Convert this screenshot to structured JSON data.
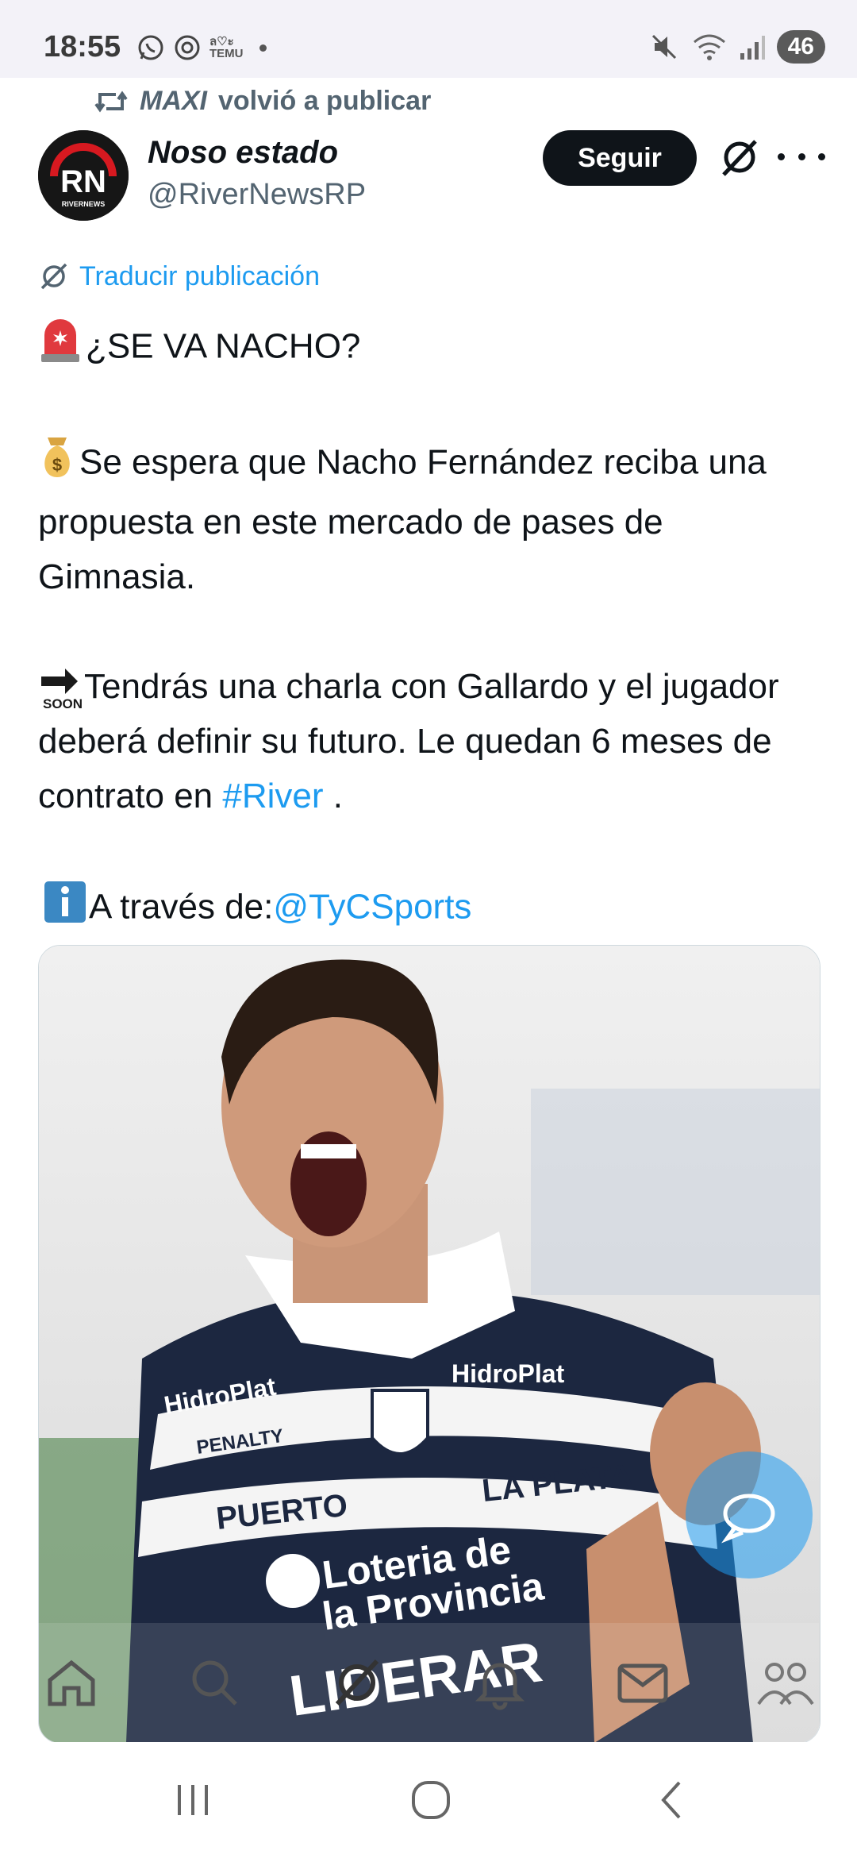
{
  "status_bar": {
    "time": "18:55",
    "temu_top": "ล♡ะ",
    "temu_bottom": "TEMU",
    "battery": "46",
    "wifi_label": "5"
  },
  "repost": {
    "name": "MAXI",
    "text": "volvió a publicar"
  },
  "author": {
    "display_name": "Noso estado",
    "handle": "@RiverNewsRP",
    "avatar_text": "RN",
    "avatar_caption": "RIVERNEWS"
  },
  "actions": {
    "follow_label": "Seguir"
  },
  "translate_label": "Traducir publicación",
  "tweet": {
    "line1": "¿SE VA NACHO?",
    "line2": "Se espera que Nacho Fernández reciba una propuesta en este mercado de pases de Gimnasia.",
    "line3_pre": "Tendrás una charla con Gallardo y el jugador deberá definir su futuro. Le quedan 6 meses de contrato en",
    "hashtag": "#River",
    "line3_post": " .",
    "line4_pre": "A través de:",
    "mention": "@TyCSports",
    "soon_label": "SOON"
  },
  "photo": {
    "sponsor1": "HidroPlat",
    "sponsor2": "PENALTY",
    "band_left": "PUERTO",
    "band_right": "LA PLATA",
    "sponsor_main_1": "Loteria de",
    "sponsor_main_2": "la Provincia",
    "bottom_text": "LIDERAR"
  },
  "colors": {
    "accent": "#1d9bf0",
    "text": "#0f1419",
    "secondary": "#536471"
  },
  "tabs": [
    "home-icon",
    "search-icon",
    "grok-icon",
    "notifications-icon",
    "messages-icon",
    "communities-icon"
  ]
}
